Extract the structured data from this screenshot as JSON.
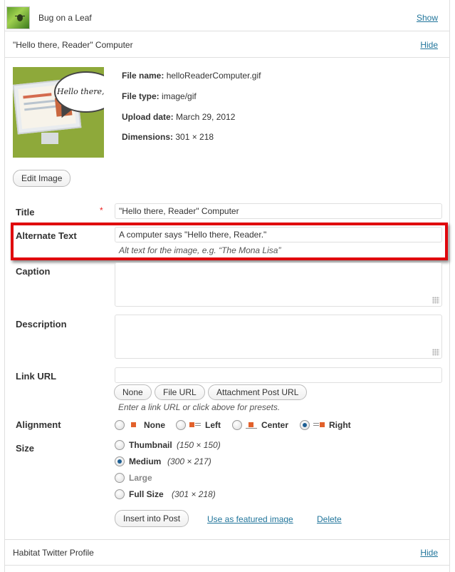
{
  "attachments": {
    "bug": {
      "title": "Bug on a Leaf",
      "toggle": "Show"
    },
    "computer": {
      "title": "\"Hello there, Reader\" Computer",
      "toggle": "Hide"
    },
    "habitat": {
      "title": "Habitat Twitter Profile",
      "toggle": "Hide"
    }
  },
  "thumbnail": {
    "speech_text": "Hello there, Reade"
  },
  "file_info": {
    "file_name_label": "File name:",
    "file_name": "helloReaderComputer.gif",
    "file_type_label": "File type:",
    "file_type": "image/gif",
    "upload_date_label": "Upload date:",
    "upload_date": "March 29, 2012",
    "dimensions_label": "Dimensions:",
    "dimensions": "301 × 218"
  },
  "edit_image_label": "Edit Image",
  "fields": {
    "title": {
      "label": "Title",
      "required_mark": "*",
      "value": "\"Hello there, Reader\" Computer"
    },
    "alt": {
      "label": "Alternate Text",
      "value": "A computer says \"Hello there, Reader.\"",
      "help": "Alt text for the image, e.g. “The Mona Lisa”"
    },
    "caption": {
      "label": "Caption",
      "value": ""
    },
    "description": {
      "label": "Description",
      "value": ""
    },
    "link_url": {
      "label": "Link URL",
      "value": "",
      "buttons": [
        "None",
        "File URL",
        "Attachment Post URL"
      ],
      "help": "Enter a link URL or click above for presets."
    }
  },
  "alignment": {
    "label": "Alignment",
    "options": [
      "None",
      "Left",
      "Center",
      "Right"
    ],
    "selected": "Right"
  },
  "size": {
    "label": "Size",
    "options": [
      {
        "label": "Thumbnail",
        "dims": "(150 × 150)"
      },
      {
        "label": "Medium",
        "dims": "(300 × 217)"
      },
      {
        "label": "Large",
        "dims": ""
      },
      {
        "label": "Full Size",
        "dims": "(301 × 218)"
      }
    ],
    "selected": "Medium"
  },
  "actions": {
    "insert": "Insert into Post",
    "featured": "Use as featured image",
    "delete": "Delete"
  },
  "colors": {
    "link": "#21759b",
    "highlight": "#e0060d",
    "required": "#e22",
    "radio_selected": "#1e5f94"
  }
}
